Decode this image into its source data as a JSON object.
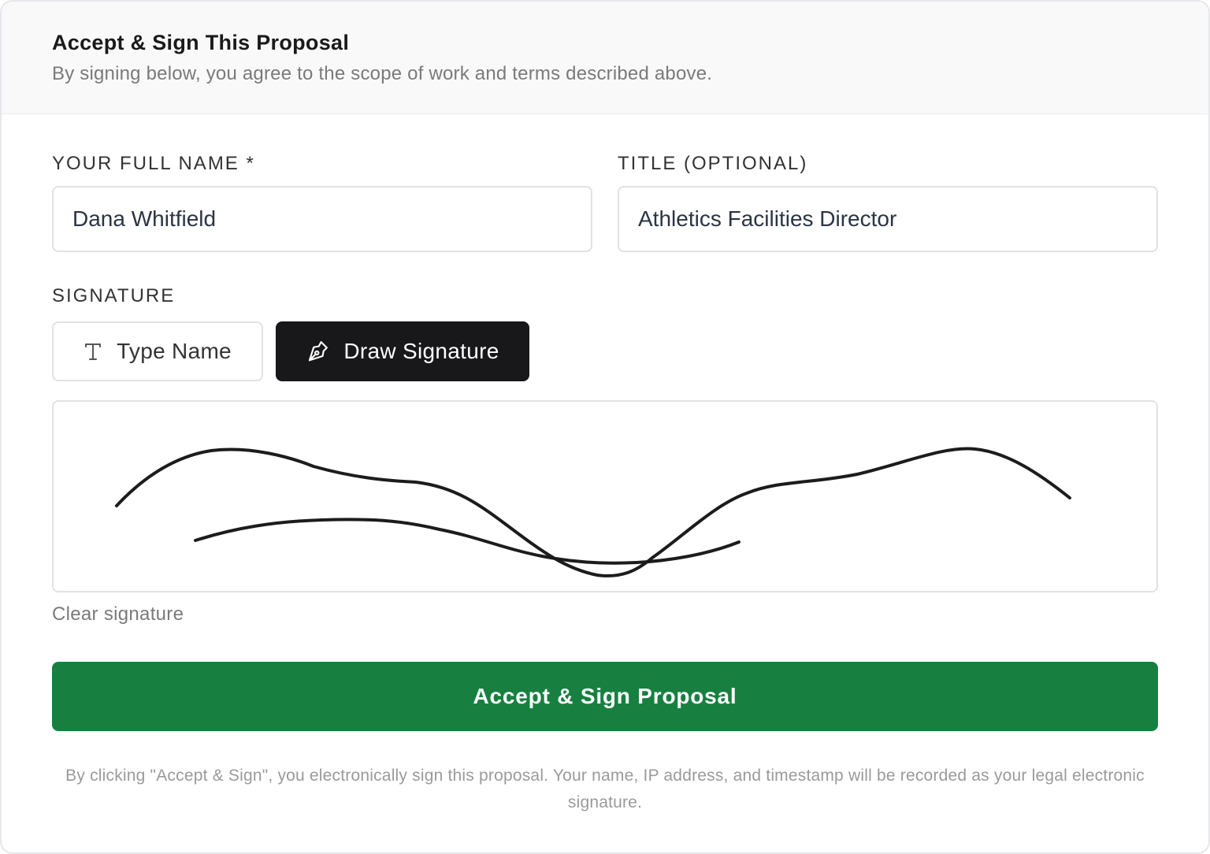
{
  "header": {
    "title": "Accept & Sign This Proposal",
    "subtitle": "By signing below, you agree to the scope of work and terms described above."
  },
  "form": {
    "full_name": {
      "label": "YOUR FULL NAME *",
      "value": "Dana Whitfield"
    },
    "title_field": {
      "label": "TITLE (OPTIONAL)",
      "value": "Athletics Facilities Director"
    },
    "signature": {
      "label": "SIGNATURE",
      "modes": [
        {
          "label": "Type Name",
          "icon": "text-type-icon",
          "active": false
        },
        {
          "label": "Draw Signature",
          "icon": "pen-nib-icon",
          "active": true
        }
      ],
      "clear_label": "Clear signature"
    },
    "submit_label": "Accept & Sign Proposal",
    "legal_text": "By clicking \"Accept & Sign\", you electronically sign this proposal. Your name, IP address, and timestamp will be recorded as your legal electronic signature."
  },
  "colors": {
    "accent_green": "#178040",
    "active_mode_bg": "#18181b",
    "ink": "#1c1c1c"
  }
}
